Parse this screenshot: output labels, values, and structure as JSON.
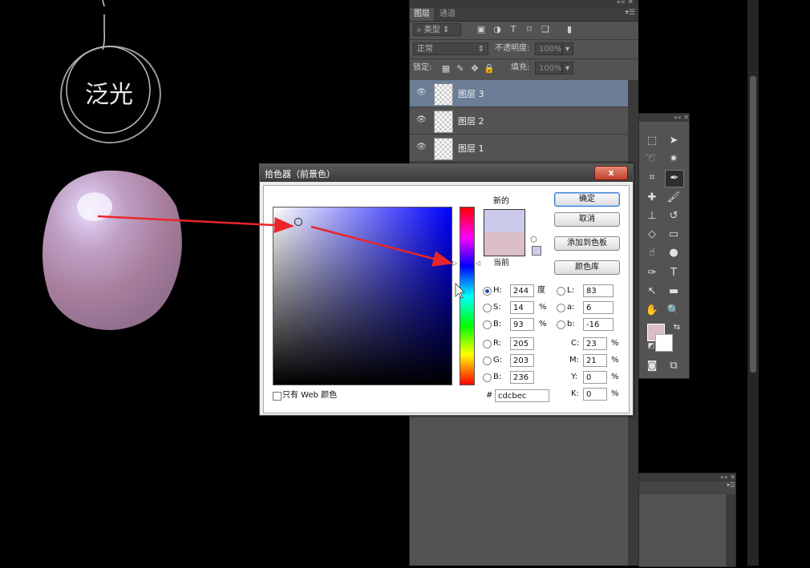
{
  "layers_panel": {
    "tabs": [
      "图层",
      "通道"
    ],
    "filter_label": "类型",
    "blend_mode": "正常",
    "opacity_label": "不透明度:",
    "opacity_value": "100%",
    "lock_label": "锁定:",
    "fill_label": "填充:",
    "fill_value": "100%",
    "layers": [
      {
        "name": "图层 3",
        "selected": true
      },
      {
        "name": "图层 2",
        "selected": false
      },
      {
        "name": "图层 1",
        "selected": false
      }
    ]
  },
  "canvas": {
    "sketch_text": "泛光",
    "sphere_color": "#b48aa8"
  },
  "dialog": {
    "title": "拾色器（前景色）",
    "close_label": "x",
    "new_label": "新的",
    "current_label": "当前",
    "new_color": "#cdcbec",
    "current_color": "#dcbec6",
    "buttons": {
      "ok": "确定",
      "cancel": "取消",
      "add_swatch": "添加到色板",
      "libraries": "颜色库"
    },
    "hsb": {
      "h_label": "H:",
      "h_value": "244",
      "h_unit": "度",
      "s_label": "S:",
      "s_value": "14",
      "s_unit": "%",
      "b_label": "B:",
      "b_value": "93",
      "b_unit": "%"
    },
    "lab": {
      "l_label": "L:",
      "l_value": "83",
      "a_label": "a:",
      "a_value": "6",
      "b_label": "b:",
      "b_value": "-16"
    },
    "rgb": {
      "r_label": "R:",
      "r_value": "205",
      "g_label": "G:",
      "g_value": "203",
      "b_label": "B:",
      "b_value": "236"
    },
    "cmyk": {
      "c_label": "C:",
      "c_value": "23",
      "m_label": "M:",
      "m_value": "21",
      "y_label": "Y:",
      "y_value": "0",
      "k_label": "K:",
      "k_value": "0",
      "unit": "%"
    },
    "hex_label": "#",
    "hex_value": "cdcbec",
    "web_only_label": "只有 Web 颜色"
  },
  "tools": {
    "foreground_color": "#dcbec6",
    "background_color": "#ffffff"
  },
  "annotation": {
    "arrow_color": "#e8262a"
  }
}
